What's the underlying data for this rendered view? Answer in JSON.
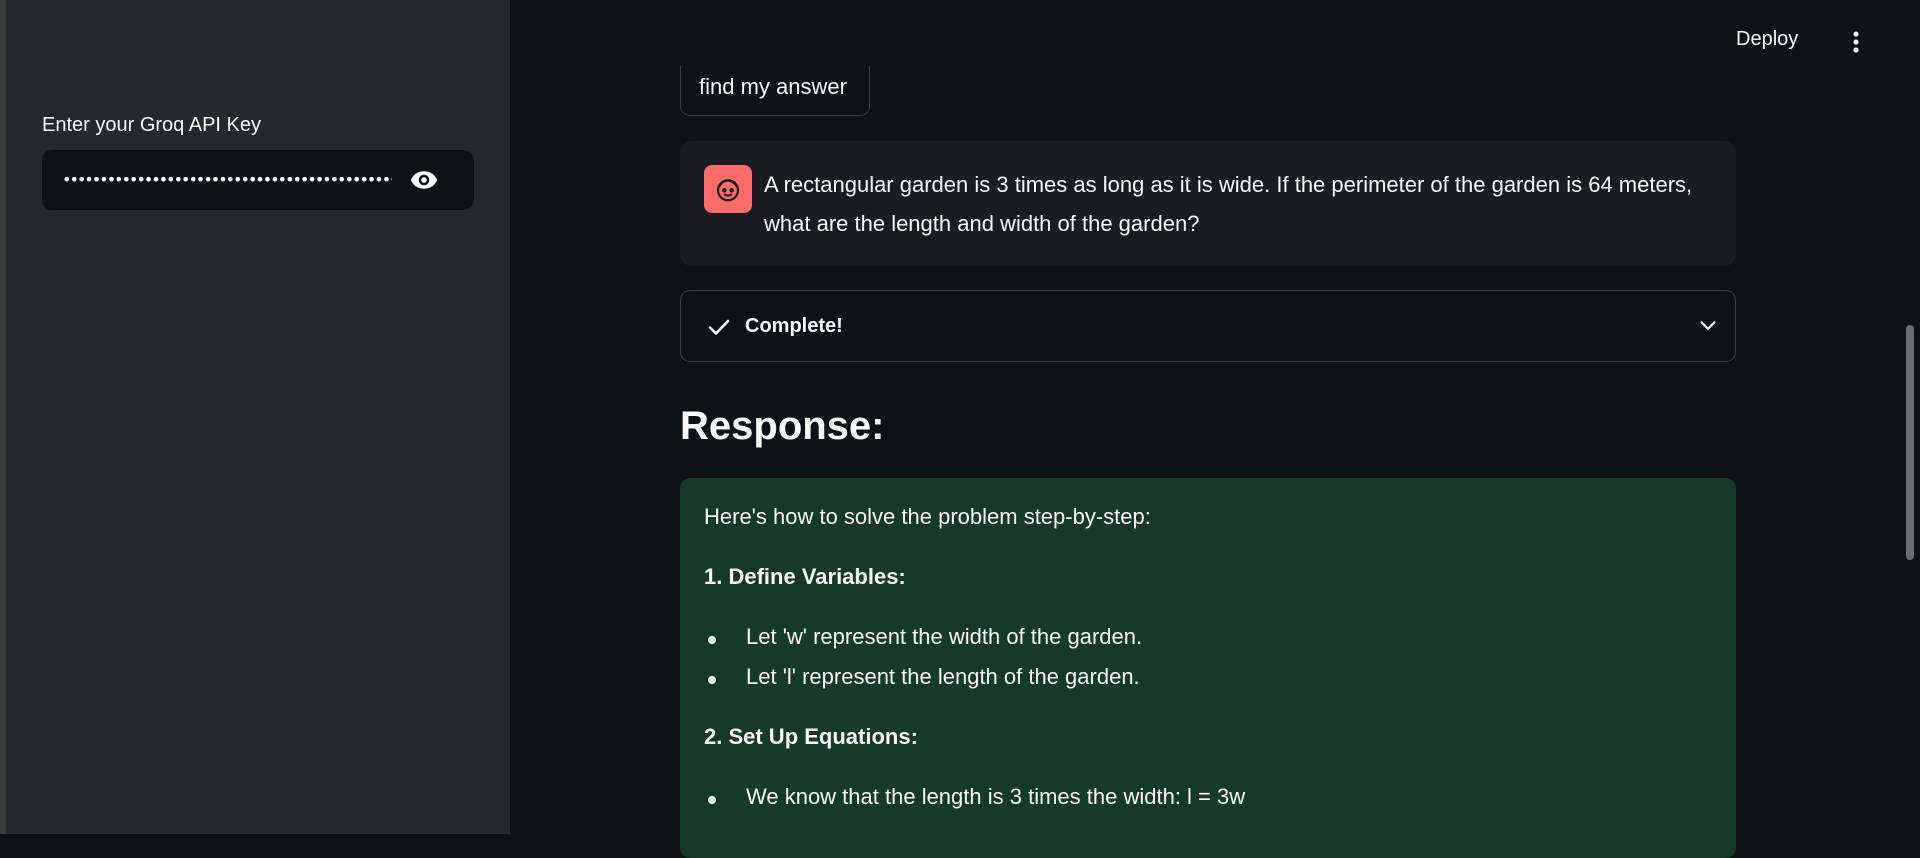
{
  "sidebar": {
    "api_key_label": "Enter your Groq API Key",
    "api_key_masked": "•••••••••••••••••••••••••••••••••••••••••••••••••••••••••••••••••",
    "eye_icon": "eye-icon"
  },
  "header": {
    "deploy_label": "Deploy",
    "menu_icon": "kebab-menu-icon"
  },
  "chat": {
    "example_chip_text": "find my answer",
    "user_message": "A rectangular garden is 3 times as long as it is wide. If the perimeter of the garden is 64 meters, what are the length and width of the garden?",
    "avatar_icon": "user-face-icon",
    "avatar_color": "#ff6b6b",
    "status_label": "Complete!"
  },
  "response": {
    "heading": "Response:",
    "intro": "Here's how to solve the problem step-by-step:",
    "step1_title": "1. Define Variables:",
    "step1_items": [
      "Let 'w' represent the width of the garden.",
      "Let 'l' represent the length of the garden."
    ],
    "step2_title": "2. Set Up Equations:",
    "step2_items": [
      "We know that the length is 3 times the width: l = 3w"
    ],
    "box_color": "#173928"
  }
}
